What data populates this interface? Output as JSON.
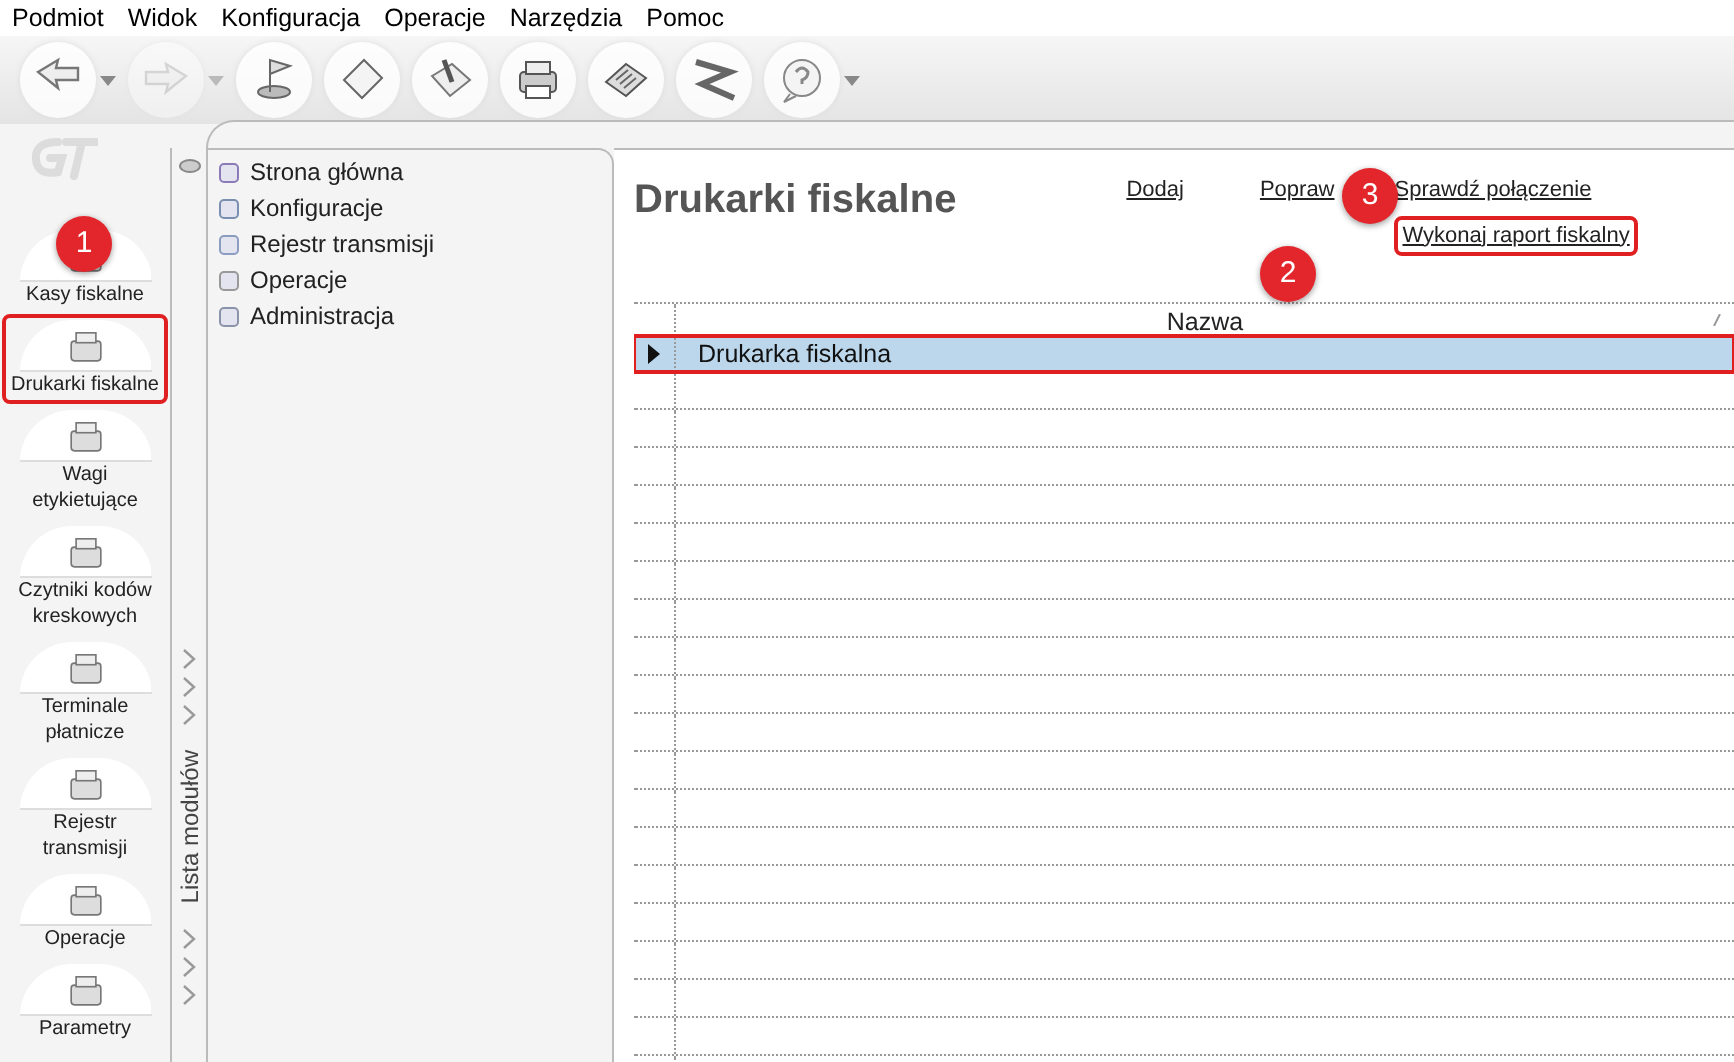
{
  "menu": [
    "Podmiot",
    "Widok",
    "Konfiguracja",
    "Operacje",
    "Narzędzia",
    "Pomoc"
  ],
  "toolbar": [
    {
      "dropdown": true,
      "disabled": false
    },
    {
      "dropdown": true,
      "disabled": true
    },
    {
      "dropdown": false,
      "disabled": false
    },
    {
      "dropdown": false,
      "disabled": false
    },
    {
      "dropdown": false,
      "disabled": false
    },
    {
      "dropdown": false,
      "disabled": false
    },
    {
      "dropdown": false,
      "disabled": false
    },
    {
      "dropdown": false,
      "disabled": false
    },
    {
      "dropdown": true,
      "disabled": false
    }
  ],
  "nav": [
    {
      "label": "Kasy fiskalne",
      "highlighted": false
    },
    {
      "label": "Drukarki fiskalne",
      "highlighted": true
    },
    {
      "label": "Wagi etykietujące",
      "highlighted": false
    },
    {
      "label": "Czytniki kodów kreskowych",
      "highlighted": false
    },
    {
      "label": "Terminale płatnicze",
      "highlighted": false
    },
    {
      "label": "Rejestr transmisji",
      "highlighted": false
    },
    {
      "label": "Operacje",
      "highlighted": false
    },
    {
      "label": "Parametry",
      "highlighted": false
    }
  ],
  "module_strip": {
    "label": "Lista modułów"
  },
  "tree": [
    "Strona główna",
    "Konfiguracje",
    "Rejestr transmisji",
    "Operacje",
    "Administracja"
  ],
  "page": {
    "title": "Drukarki fiskalne",
    "actions": [
      {
        "label": "Dodaj",
        "highlighted": false
      },
      {
        "label": "Popraw",
        "highlighted": false
      },
      {
        "label": "Sprawdź połączenie",
        "highlighted": false
      },
      {
        "label": "Wykonaj raport fiskalny",
        "highlighted": true
      }
    ]
  },
  "table": {
    "columns": [
      "Nazwa"
    ],
    "rows": [
      {
        "cells": [
          "Drukarka fiskalna"
        ],
        "selected": true,
        "highlighted": true
      }
    ]
  },
  "callouts": [
    "1",
    "2",
    "3"
  ]
}
